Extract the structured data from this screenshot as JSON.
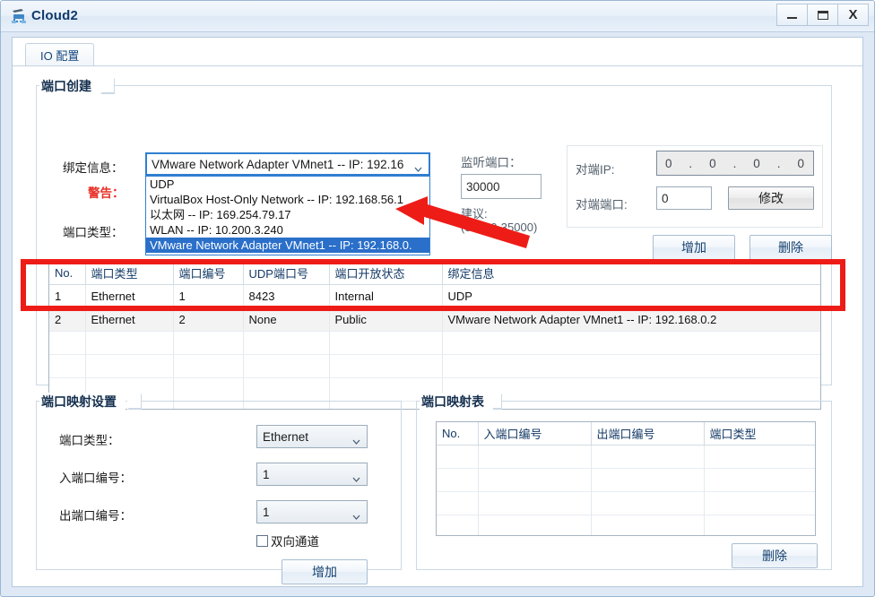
{
  "window": {
    "title": "Cloud2",
    "icon": "cloud-network-icon",
    "controls": {
      "minimize": "minimize-icon",
      "maximize": "maximize-icon",
      "close": "X"
    }
  },
  "tabs": [
    {
      "label": "IO 配置",
      "active": true
    }
  ],
  "port_create": {
    "title": "端口创建",
    "binding_label": "绑定信息：",
    "warning_label": "警告：",
    "warning_text": "",
    "port_type_label": "端口类型：",
    "binding_value": "VMware Network Adapter VMnet1 -- IP: 192.16",
    "dropdown_options": [
      "UDP",
      "VirtualBox Host-Only Network -- IP: 192.168.56.1",
      "以太网 -- IP: 169.254.79.17",
      "WLAN -- IP: 10.200.3.240",
      "VMware Network Adapter VMnet1 -- IP: 192.168.0."
    ],
    "dropdown_selected_index": 4,
    "listen_port_label": "监听端口：",
    "listen_port_value": "30000",
    "suggest_label": "建议:",
    "suggest_range": "(30000-35000)",
    "peer_ip_label": "对端IP:",
    "peer_ip_octets": [
      "0",
      "0",
      "0",
      "0"
    ],
    "peer_port_label": "对端端口:",
    "peer_port_value": "0",
    "modify_button": "修改",
    "add_button": "增加",
    "delete_button": "删除"
  },
  "port_table": {
    "columns": [
      "No.",
      "端口类型",
      "端口编号",
      "UDP端口号",
      "端口开放状态",
      "绑定信息"
    ],
    "rows": [
      {
        "no": "1",
        "type": "Ethernet",
        "number": "1",
        "udp": "8423",
        "state": "Internal",
        "binding": "UDP"
      },
      {
        "no": "2",
        "type": "Ethernet",
        "number": "2",
        "udp": "None",
        "state": "Public",
        "binding": "VMware Network Adapter VMnet1 -- IP: 192.168.0.2"
      }
    ],
    "empty_rows": 4
  },
  "mapping_settings": {
    "title": "端口映射设置",
    "port_type_label": "端口类型：",
    "port_type_value": "Ethernet",
    "in_port_label": "入端口编号：",
    "in_port_value": "1",
    "out_port_label": "出端口编号：",
    "out_port_value": "1",
    "bidirectional_label": "双向通道",
    "bidirectional_checked": false,
    "add_button": "增加"
  },
  "mapping_table": {
    "title": "端口映射表",
    "columns": [
      "No.",
      "入端口编号",
      "出端口编号",
      "端口类型"
    ],
    "rows": [],
    "empty_rows": 5,
    "delete_button": "删除"
  },
  "annotation": {
    "highlight_color": "#ee1c17",
    "arrow": "red-arrow-pointing-to-selected-option"
  }
}
